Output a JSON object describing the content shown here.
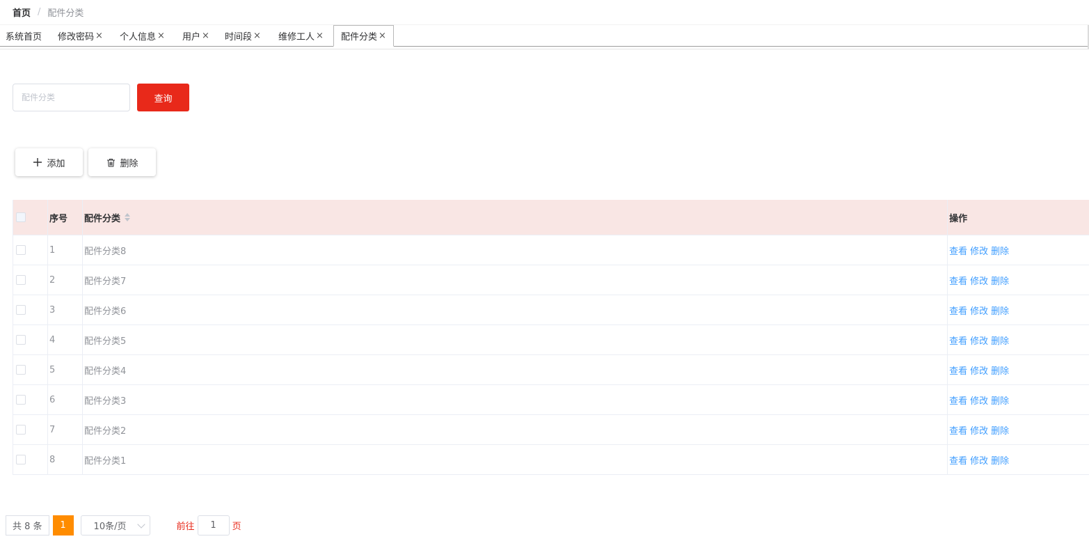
{
  "breadcrumb": {
    "home": "首页",
    "separator": "/",
    "current": "配件分类"
  },
  "tabs": [
    {
      "label": "系统首页",
      "closable": false
    },
    {
      "label": "修改密码",
      "closable": true
    },
    {
      "label": "个人信息",
      "closable": true
    },
    {
      "label": "用户",
      "closable": true
    },
    {
      "label": "时间段",
      "closable": true
    },
    {
      "label": "维修工人",
      "closable": true
    },
    {
      "label": "配件分类",
      "closable": true,
      "active": true
    }
  ],
  "close_glyph": "×",
  "search": {
    "placeholder": "配件分类",
    "value": "",
    "button_label": "查询",
    "button_color": "#e8291a"
  },
  "actions": {
    "add_label": "添加",
    "delete_label": "删除"
  },
  "table": {
    "header_bg": "#f9e6e4",
    "columns": {
      "index": "序号",
      "name": "配件分类",
      "ops": "操作"
    },
    "op_labels": {
      "view": "查看",
      "edit": "修改",
      "delete": "删除"
    },
    "rows": [
      {
        "index": "1",
        "name": "配件分类8"
      },
      {
        "index": "2",
        "name": "配件分类7"
      },
      {
        "index": "3",
        "name": "配件分类6"
      },
      {
        "index": "4",
        "name": "配件分类5"
      },
      {
        "index": "5",
        "name": "配件分类4"
      },
      {
        "index": "6",
        "name": "配件分类3"
      },
      {
        "index": "7",
        "name": "配件分类2"
      },
      {
        "index": "8",
        "name": "配件分类1"
      }
    ]
  },
  "pagination": {
    "total_text": "共 8 条",
    "current_page": "1",
    "page_size": "10条/页",
    "goto_label": "前往",
    "goto_value": "1",
    "page_suffix": "页",
    "active_color": "#ff8c00"
  }
}
